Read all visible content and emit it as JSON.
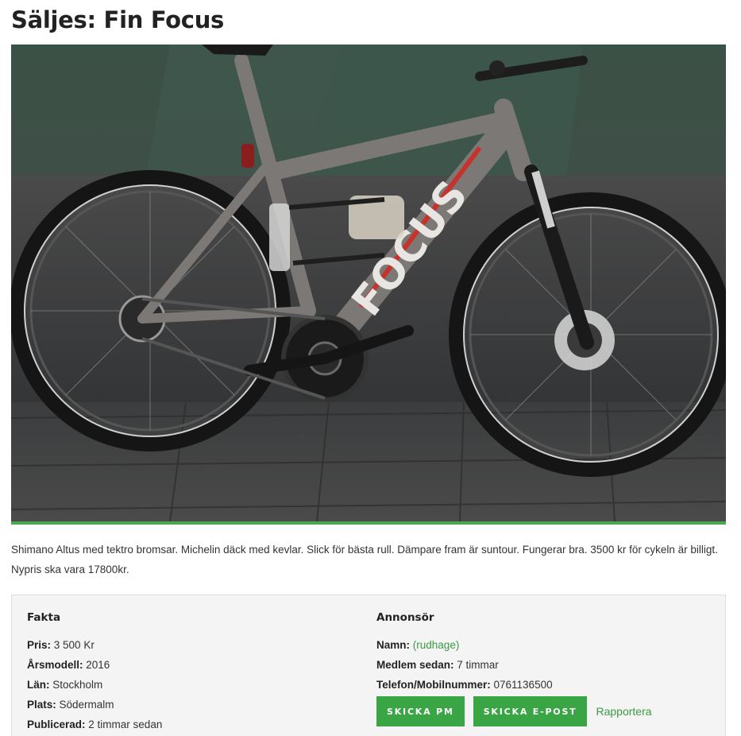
{
  "listing": {
    "title": "Säljes: Fin Focus",
    "description": "Shimano Altus med tektro bromsar. Michelin däck med kevlar. Slick för bästa rull. Dämpare fram är suntour. Fungerar bra. 3500 kr för cykeln är billigt. Nypris ska vara 17800kr.",
    "image_brand_text": "FOCUS"
  },
  "facts": {
    "heading": "Fakta",
    "rows": [
      {
        "label": "Pris:",
        "value": "3 500 Kr"
      },
      {
        "label": "Årsmodell:",
        "value": "2016"
      },
      {
        "label": "Län:",
        "value": "Stockholm"
      },
      {
        "label": "Plats:",
        "value": "Södermalm"
      },
      {
        "label": "Publicerad:",
        "value": "2 timmar sedan"
      }
    ]
  },
  "advertiser": {
    "heading": "Annonsör",
    "name_label": "Namn:",
    "name_open": "(",
    "name_value": "rudhage",
    "name_close": ")",
    "member_label": "Medlem sedan:",
    "member_value": "7 timmar",
    "phone_label": "Telefon/Mobilnummer:",
    "phone_value": "0761136500",
    "pm_button": "SKICKA PM",
    "email_button": "SKICKA E-POST",
    "report_link": "Rapportera"
  },
  "colors": {
    "accent": "#3aa545",
    "link": "#3c9a43",
    "box_bg": "#f4f4f4"
  }
}
